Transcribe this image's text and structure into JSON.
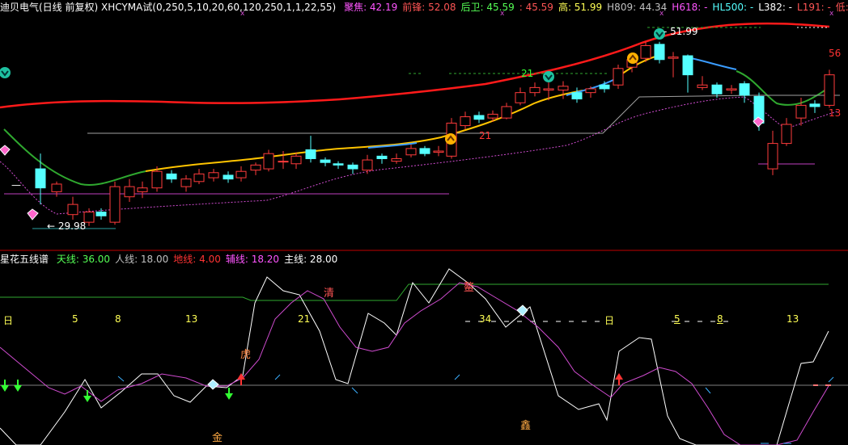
{
  "top_panel": {
    "title": "迪贝电气(日线 前复权) XHCYMA试(0,250,5,10,20,60,120,250,1,1,22,55)",
    "stats": [
      {
        "label": "聚焦:",
        "value": "42.19",
        "color": "#ff55ff"
      },
      {
        "label": "前锋:",
        "value": "52.08",
        "color": "#ff5555"
      },
      {
        "label": "后卫:",
        "value": "45.59",
        "color": "#55ff55"
      },
      {
        "label": ":",
        "value": "45.59",
        "color": "#ff5555"
      },
      {
        "label": "高:",
        "value": "51.99",
        "color": "#ffff55"
      },
      {
        "label": "H809:",
        "value": "44.34",
        "color": "#c0c0c0"
      },
      {
        "label": "H618:",
        "value": "-",
        "color": "#ff55ff"
      },
      {
        "label": "HL500:",
        "value": "-",
        "color": "#55ffff"
      },
      {
        "label": "L382:",
        "value": "-",
        "color": "#ffffff"
      },
      {
        "label": "L191:",
        "value": "-",
        "color": "#ff5555"
      },
      {
        "label": "低:",
        "value": "-",
        "color": "#ff5555"
      },
      {
        "label": "MA1:",
        "value": "-",
        "color": "#ffffff"
      }
    ],
    "price_labels": {
      "high": "51.99",
      "low": "29.98",
      "count_21a": "21",
      "count_21b": "21",
      "count_56": "56",
      "count_13": "13"
    }
  },
  "bottom_panel": {
    "title": "星花五线谱",
    "lines": [
      {
        "label": "天线:",
        "value": "36.00",
        "color": "#55ff55"
      },
      {
        "label": "人线:",
        "value": "18.00",
        "color": "#c0c0c0"
      },
      {
        "label": "地线:",
        "value": "4.00",
        "color": "#ff3333"
      },
      {
        "label": "辅线:",
        "value": "18.20",
        "color": "#ff55ff"
      },
      {
        "label": "主线:",
        "value": "28.00",
        "color": "#ffffff"
      }
    ],
    "fib_labels": [
      "日",
      "5",
      "8",
      "13",
      "21",
      "34",
      "日",
      "5",
      "8",
      "13"
    ],
    "chars": {
      "qing": "清",
      "hu": "虎",
      "jin": "金",
      "xin": "鑫",
      "ao": "鳌"
    }
  },
  "colors": {
    "background": "#000000",
    "divider": "#c00000",
    "up_candle": "#ff3b3b",
    "down_candle": "#55ffff",
    "ma_red": "#ff1a1a",
    "ma_segment_green": "#2fa82f",
    "ma_segment_yellow": "#ffc400",
    "ma_segment_blue": "#3a9cff",
    "support_line": "#a0a0a0",
    "dotted_magenta": "#d04cd0"
  },
  "candles": [
    [
      50,
      42.0,
      40.5,
      43.2,
      39.2,
      "down"
    ],
    [
      70,
      40.2,
      40.8,
      41.0,
      39.8,
      "up"
    ],
    [
      90,
      38.4,
      39.2,
      39.8,
      38.0,
      "up"
    ],
    [
      110,
      37.8,
      38.6,
      38.9,
      37.5,
      "up"
    ],
    [
      125,
      38.3,
      38.6,
      38.9,
      38.0,
      "down"
    ],
    [
      142,
      37.8,
      40.6,
      41.0,
      37.6,
      "up"
    ],
    [
      160,
      39.8,
      40.6,
      41.2,
      39.4,
      "up"
    ],
    [
      176,
      40.2,
      40.5,
      41.0,
      39.7,
      "up"
    ],
    [
      194,
      40.5,
      41.8,
      42.2,
      40.2,
      "up"
    ],
    [
      212,
      41.2,
      41.6,
      41.9,
      40.9,
      "down"
    ],
    [
      230,
      40.6,
      41.2,
      41.5,
      40.2,
      "up"
    ],
    [
      246,
      41.0,
      41.6,
      42.0,
      40.8,
      "up"
    ],
    [
      264,
      41.3,
      41.7,
      42.0,
      41.0,
      "up"
    ],
    [
      282,
      41.5,
      41.2,
      41.8,
      40.9,
      "down"
    ],
    [
      298,
      41.3,
      41.8,
      42.2,
      41.0,
      "up"
    ],
    [
      316,
      41.9,
      42.3,
      42.5,
      41.5,
      "up"
    ],
    [
      332,
      42.0,
      43.2,
      43.5,
      41.8,
      "up"
    ],
    [
      350,
      42.6,
      42.6,
      43.4,
      42.0,
      "up"
    ],
    [
      366,
      42.4,
      43.0,
      43.3,
      42.0,
      "up"
    ],
    [
      384,
      43.5,
      42.8,
      44.6,
      42.5,
      "down"
    ],
    [
      402,
      42.7,
      42.5,
      42.9,
      42.2,
      "down"
    ],
    [
      418,
      42.4,
      42.3,
      42.6,
      42.0,
      "down"
    ],
    [
      436,
      42.3,
      42.0,
      42.5,
      41.6,
      "down"
    ],
    [
      454,
      41.9,
      42.7,
      43.1,
      41.6,
      "up"
    ],
    [
      472,
      43.0,
      42.8,
      43.2,
      42.4,
      "down"
    ],
    [
      490,
      42.6,
      42.8,
      43.2,
      42.4,
      "up"
    ],
    [
      508,
      43.1,
      43.6,
      43.9,
      42.9,
      "up"
    ],
    [
      525,
      43.6,
      43.2,
      43.8,
      43.0,
      "down"
    ],
    [
      542,
      43.3,
      43.4,
      43.8,
      43.0,
      "up"
    ],
    [
      558,
      43.0,
      45.6,
      46.0,
      42.8,
      "up"
    ],
    [
      575,
      45.4,
      46.1,
      46.5,
      45.1,
      "up"
    ],
    [
      592,
      46.2,
      45.9,
      46.5,
      45.6,
      "down"
    ],
    [
      609,
      46.0,
      46.3,
      46.6,
      45.7,
      "up"
    ],
    [
      626,
      46.0,
      46.9,
      47.2,
      45.9,
      "up"
    ],
    [
      643,
      47.2,
      48.0,
      48.4,
      47.0,
      "up"
    ],
    [
      661,
      48.0,
      48.4,
      48.8,
      47.7,
      "up"
    ],
    [
      678,
      48.2,
      48.3,
      48.8,
      47.4,
      "up"
    ],
    [
      696,
      48.5,
      48.2,
      48.9,
      47.5,
      "up"
    ],
    [
      713,
      47.5,
      48.0,
      48.4,
      47.2,
      "down"
    ],
    [
      730,
      48.0,
      48.3,
      48.5,
      47.6,
      "up"
    ],
    [
      747,
      48.3,
      48.6,
      48.9,
      48.0,
      "down"
    ],
    [
      764,
      48.6,
      49.9,
      50.2,
      48.3,
      "up"
    ],
    [
      781,
      50.0,
      50.6,
      50.9,
      49.6,
      "up"
    ],
    [
      798,
      50.7,
      51.7,
      52.0,
      50.4,
      "up"
    ],
    [
      815,
      51.8,
      50.6,
      52.0,
      50.3,
      "down"
    ],
    [
      832,
      50.8,
      50.7,
      51.2,
      49.2,
      "up"
    ],
    [
      850,
      50.9,
      49.4,
      51.0,
      48.0,
      "down"
    ],
    [
      868,
      48.4,
      48.6,
      49.3,
      48.2,
      "up"
    ],
    [
      886,
      48.6,
      47.9,
      48.8,
      47.6,
      "down"
    ],
    [
      904,
      48.2,
      48.3,
      48.6,
      47.9,
      "up"
    ],
    [
      920,
      48.7,
      47.8,
      48.9,
      47.2,
      "down"
    ],
    [
      938,
      47.7,
      45.6,
      48.0,
      45.0,
      "down"
    ],
    [
      955,
      42.0,
      44.0,
      45.0,
      41.5,
      "up"
    ],
    [
      972,
      44.0,
      45.5,
      46.0,
      43.8,
      "up"
    ],
    [
      990,
      46.0,
      47.0,
      47.6,
      45.4,
      "up"
    ],
    [
      1007,
      47.1,
      46.9,
      47.4,
      46.4,
      "down"
    ],
    [
      1025,
      47.0,
      49.4,
      49.8,
      46.8,
      "up"
    ]
  ]
}
